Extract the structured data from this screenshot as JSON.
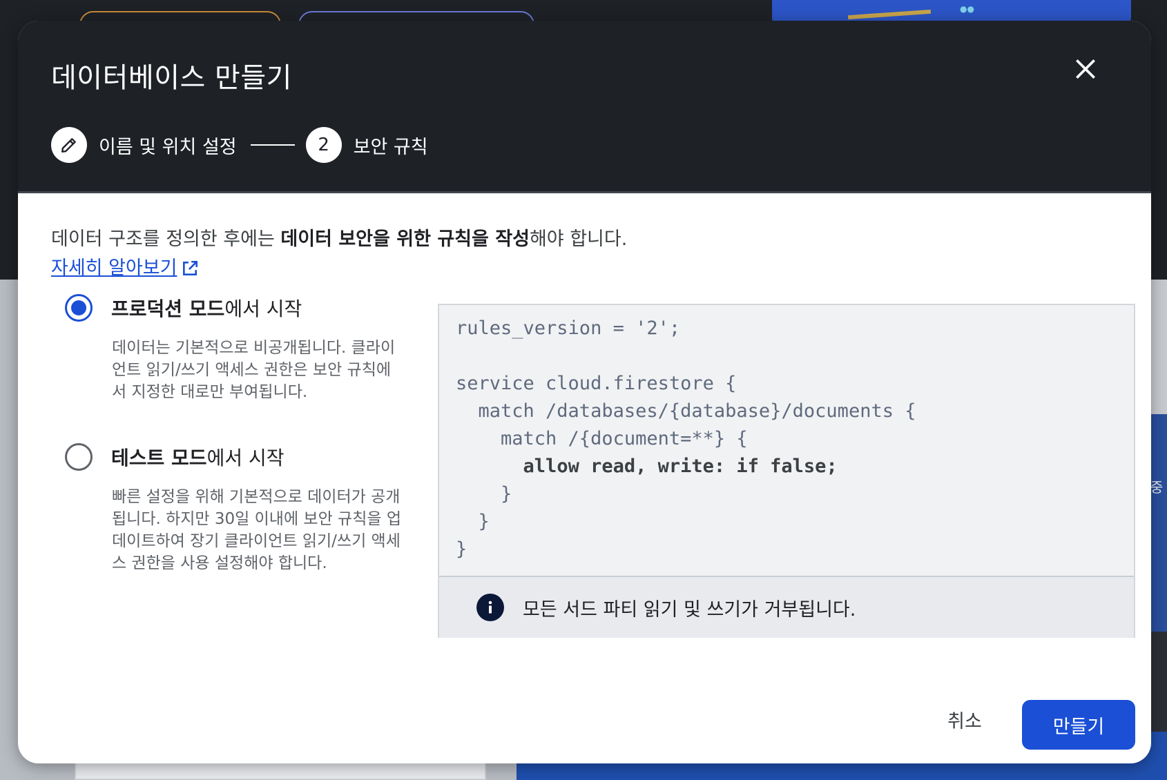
{
  "background": {
    "side_text": "중"
  },
  "dialog": {
    "title": "데이터베이스 만들기",
    "close_icon": "close-icon"
  },
  "stepper": {
    "steps": [
      {
        "icon": "pencil-icon",
        "label": "이름 및 위치 설정",
        "state": "completed"
      },
      {
        "number": "2",
        "label": "보안 규칙",
        "state": "active"
      }
    ]
  },
  "intro": {
    "text_before": "데이터 구조를 정의한 후에는 ",
    "text_bold": "데이터 보안을 위한 규칙을 작성",
    "text_after": "해야 합니다.",
    "learn_more": "자세히 알아보기",
    "learn_more_icon": "open-in-new-icon"
  },
  "modes": [
    {
      "label_bold": "프로덕션 모드",
      "label_rest": "에서 시작",
      "selected": true,
      "description": "데이터는 기본적으로 비공개됩니다. 클라이언트 읽기/쓰기 액세스 권한은 보안 규칙에서 지정한 대로만 부여됩니다."
    },
    {
      "label_bold": "테스트 모드",
      "label_rest": "에서 시작",
      "selected": false,
      "description": "빠른 설정을 위해 기본적으로 데이터가 공개됩니다. 하지만 30일 이내에 보안 규칙을 업데이트하여 장기 클라이언트 읽기/쓰기 액세스 권한을 사용 설정해야 합니다."
    }
  ],
  "rules": {
    "line1": "rules_version = '2';",
    "line2": "",
    "line3": "service cloud.firestore {",
    "line4": "  match /databases/{database}/documents {",
    "line5": "    match /{document=**} {",
    "line6_indent": "      ",
    "line6": "allow read, write: if false;",
    "line7": "    }",
    "line8": "  }",
    "line9": "}"
  },
  "notice": {
    "icon": "info-icon",
    "text": "모든 서드 파티 읽기 및 쓰기가 거부됩니다."
  },
  "actions": {
    "cancel": "취소",
    "create": "만들기"
  },
  "colors": {
    "accent": "#1a4fd6",
    "header_bg": "#1e2126"
  }
}
